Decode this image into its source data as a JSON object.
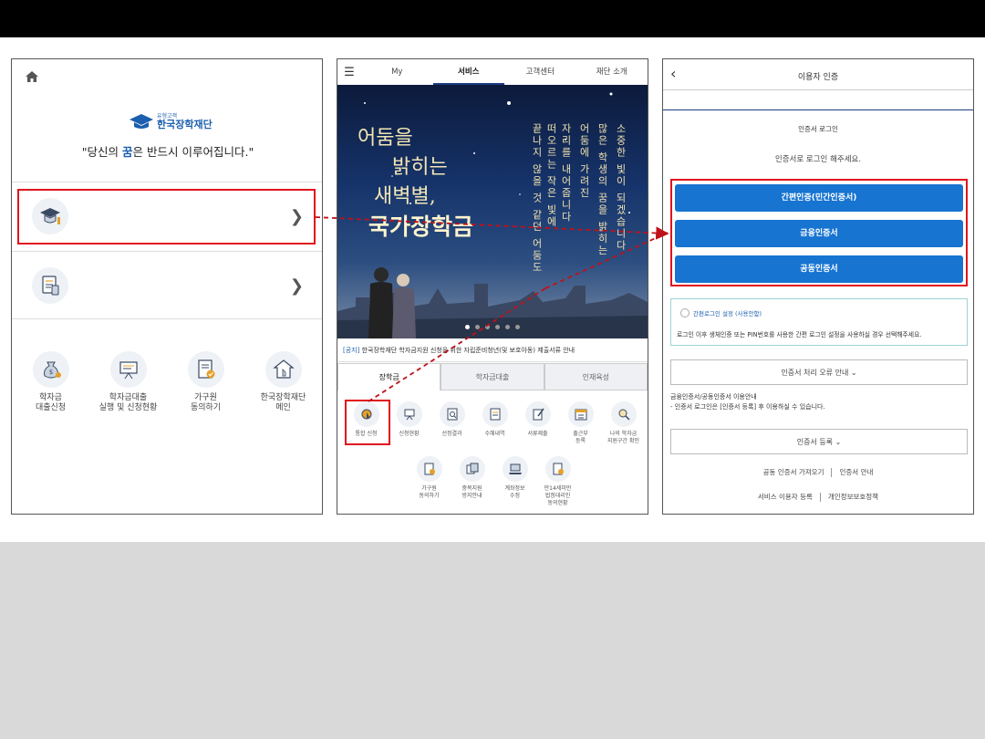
{
  "panel1": {
    "logo_small": "유형고객",
    "logo_main": "한국장학재단",
    "slogan_pre": "\"당신의 ",
    "slogan_hl": "꿈",
    "slogan_post": "은 반드시 이루어집니다.\"",
    "quick": [
      {
        "label": "학자금\n대출신청",
        "icon": "money-bag-icon"
      },
      {
        "label": "학자금대출\n실행 및 신청현황",
        "icon": "presentation-board-icon"
      },
      {
        "label": "가구원\n동의하기",
        "icon": "document-check-icon"
      },
      {
        "label": "한국장학재단\n메인",
        "icon": "home-touch-icon"
      }
    ]
  },
  "panel2": {
    "tabs": [
      "My",
      "서비스",
      "고객센터",
      "재단 소개"
    ],
    "active_tab": "서비스",
    "banner": {
      "line1": "어둠을",
      "line2": "밝히는",
      "line3": "새벽별,",
      "line4": "국가장학금",
      "vertical": [
        "소중한 빛이 되겠습니다",
        "많은 학생의 꿈을 밝히는",
        "어둠에 가려진",
        "자리를 내어줍니다",
        "떠오르는 작은 빛에",
        "끝나지 않을 것 같던 어둠도"
      ]
    },
    "notice_tag": "[공지]",
    "notice_text": " 한국장학재단 학자금지원 신청을 위한 자립준비청년(및 보호아동) 제출서류 안내",
    "subtabs": [
      "장학금",
      "학자금대출",
      "인재육성"
    ],
    "services_row1": [
      "통합 신청",
      "신청현황",
      "선정결과",
      "수혜내역",
      "서류제출",
      "출근부\n등록",
      "나의 학자금\n지원구간 확인"
    ],
    "services_row2": [
      "가구원\n동의하기",
      "중복지원\n방지안내",
      "계좌정보\n수정",
      "만14세미만\n법정대리인\n동의현황"
    ]
  },
  "panel3": {
    "title": "이용자 인증",
    "section_title": "인증서 로그인",
    "desc": "인증서로 로그인 해주세요.",
    "buttons": [
      "간편인증(민간인증서)",
      "금융인증서",
      "공동인증서"
    ],
    "simple_title": "간편로그인 설정 (사용안함)",
    "simple_desc": "로그인 이후 생체인증 또는 PIN번호를 사용한 간편 로그인 설정을 사용하실 경우 선택해주세요.",
    "error_btn": "인증서 처리 오류 안내",
    "cert_info_line1": "금융인증서/공동인증서 이용안내",
    "cert_info_line2": "- 인증서 로그인은 [인증서 등록] 후 이용하실 수 있습니다.",
    "register_btn": "인증서 등록",
    "link1": "공동 인증서 가져오기",
    "link2": "인증서 안내",
    "link3": "서비스 이용자 등록",
    "link4": "개인정보보호정책"
  },
  "colors": {
    "accent_red": "#e0141e",
    "brand_blue": "#1774d1",
    "navy": "#1c3d82"
  }
}
